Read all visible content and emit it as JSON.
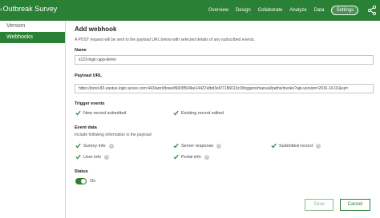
{
  "app": {
    "title": "Outbreak Survey"
  },
  "nav": {
    "tabs": [
      "Overview",
      "Design",
      "Collaborate",
      "Analyze",
      "Data",
      "Settings"
    ],
    "active": "Settings"
  },
  "sidebar": {
    "items": [
      "Version",
      "Webhooks"
    ],
    "active": "Webhooks"
  },
  "page": {
    "title": "Add webhook",
    "description": "A POST request will be sent to the payload URL below with selected details of any subscribed events."
  },
  "form": {
    "name_label": "Name",
    "name_value": "s123-logic-app-demo",
    "url_label": "Payload URL",
    "url_value": "https://prod-83.eastus.logic.azure.com:443/workflows/f66f3f504be14437afbd3ef27186613c3/triggers/manual/paths/invoke?api-version=2016-10-01&sp=",
    "trigger_label": "Trigger events",
    "triggers": [
      {
        "label": "New record submitted",
        "checked": true
      },
      {
        "label": "Existing record edited",
        "checked": true
      }
    ],
    "event_data_label": "Event data",
    "event_data_sub": "Include following information in the payload",
    "event_data": [
      {
        "label": "Survey info",
        "checked": true,
        "info": true
      },
      {
        "label": "Server response",
        "checked": true,
        "info": true
      },
      {
        "label": "Submitted record",
        "checked": true,
        "info": true
      },
      {
        "label": "User info",
        "checked": true,
        "info": true
      },
      {
        "label": "Portal info",
        "checked": true,
        "info": true
      }
    ],
    "status_label": "Status",
    "status_value": "On",
    "status_on": true
  },
  "buttons": {
    "save": "Save",
    "cancel": "Cancel"
  },
  "colors": {
    "brand": "#2a8034",
    "border": "#c6c6c6"
  },
  "icons": {
    "share": "share-icon",
    "back": "back-chevron-icon",
    "check": "check-icon",
    "info": "info-icon"
  }
}
